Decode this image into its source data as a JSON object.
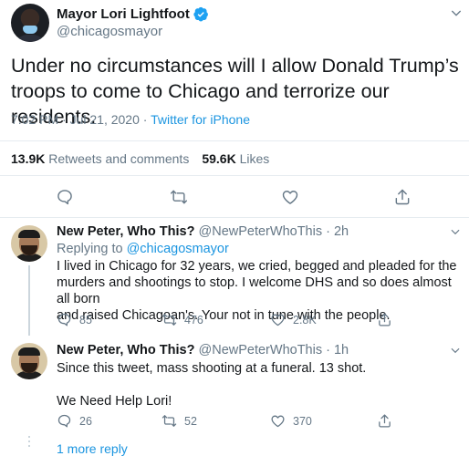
{
  "main_tweet": {
    "author_name": "Mayor Lori Lightfoot",
    "handle": "@chicagosmayor",
    "text": "Under no circumstances will I allow Donald Trump’s\ntroops to come to Chicago and terrorize our residents.",
    "time": "7:02 PM · Jul 21, 2020 · ",
    "source": "Twitter for iPhone",
    "retweets_count": "13.9K",
    "retweets_label": " Retweets and comments",
    "likes_count": "59.6K",
    "likes_label": " Likes",
    "icons": [
      "reply-icon",
      "retweet-icon",
      "like-icon",
      "share-icon",
      "verified-icon",
      "chevron-down-icon"
    ]
  },
  "replies": [
    {
      "author_name": "New Peter, Who This?",
      "handle": " @NewPeterWhoThis · 2h",
      "replying_prefix": "Replying to ",
      "replying_to": "@chicagosmayor",
      "text": "I lived in Chicago for 32 years, we cried, begged and pleaded for the\nmurders and shootings to stop. I welcome DHS and so does almost all born\nand raised Chicagoan's.  Your not in tune with the people.",
      "replies_count": "85",
      "retweets_count": "476",
      "likes_count": "2.8K"
    },
    {
      "author_name": "New Peter, Who This?",
      "handle": " @NewPeterWhoThis · 1h",
      "text": "Since this tweet, mass shooting at a funeral. 13 shot.\n\nWe Need Help Lori!",
      "replies_count": "26",
      "retweets_count": "52",
      "likes_count": "370"
    }
  ],
  "more_replies_label": "1 more reply",
  "colors": {
    "link": "#1b95e0",
    "secondary_text": "#657786",
    "primary_text": "#14171a",
    "divider": "#e6ecf0"
  }
}
